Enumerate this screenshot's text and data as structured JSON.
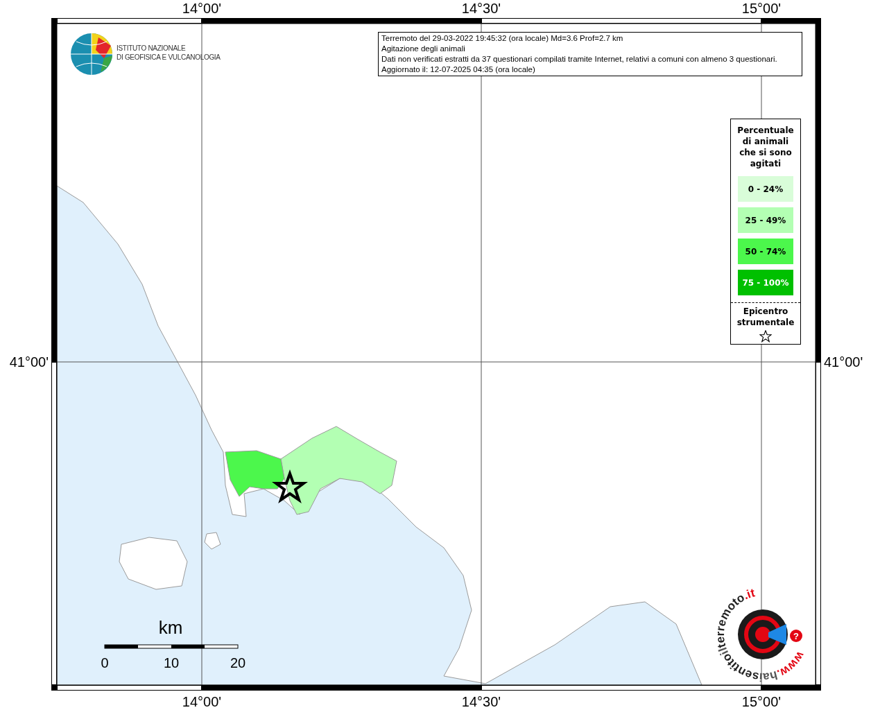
{
  "map": {
    "x_ticks_top": [
      "14°00'",
      "14°30'",
      "15°00'"
    ],
    "x_ticks_bottom": [
      "14°00'",
      "14°30'",
      "15°00'"
    ],
    "y_ticks_left": [
      "41°00'"
    ],
    "y_ticks_right": [
      "41°00'"
    ]
  },
  "logo": {
    "lines": [
      "ISTITUTO NAZIONALE",
      "DI GEOFISICA E VULCANOLOGIA"
    ]
  },
  "info_box": {
    "lines": [
      "Terremoto del 29-03-2022 19:45:32 (ora locale) Md=3.6 Prof=2.7 km",
      "Agitazione degli animali",
      "Dati non verificati estratti da 37 questionari compilati tramite Internet, relativi a comuni con almeno 3 questionari.",
      "Aggiornato il: 12-07-2025 04:35 (ora locale)"
    ]
  },
  "legend": {
    "title_lines": [
      "Percentuale",
      "di animali",
      "che si sono",
      "agitati"
    ],
    "items": [
      {
        "label": "0 - 24%",
        "color": "#d9fdd9"
      },
      {
        "label": "25 - 49%",
        "color": "#b3ffb3"
      },
      {
        "label": "50 - 74%",
        "color": "#4cf74c"
      },
      {
        "label": "75 - 100%",
        "color": "#00c000"
      }
    ],
    "epicenter_lines": [
      "Epicentro",
      "strumentale"
    ]
  },
  "scale_bar": {
    "unit": "km",
    "labels": [
      "0",
      "10",
      "20"
    ]
  },
  "badge": {
    "parts": [
      {
        "text": "www.",
        "color": "#e30613"
      },
      {
        "text": "hai",
        "color": "#555555"
      },
      {
        "text": "sentito",
        "color": "#222222"
      },
      {
        "text": "il",
        "color": "#555555"
      },
      {
        "text": "terremoto",
        "color": "#222222"
      },
      {
        "text": ".it",
        "color": "#e30613"
      }
    ],
    "icon_text": "?"
  }
}
